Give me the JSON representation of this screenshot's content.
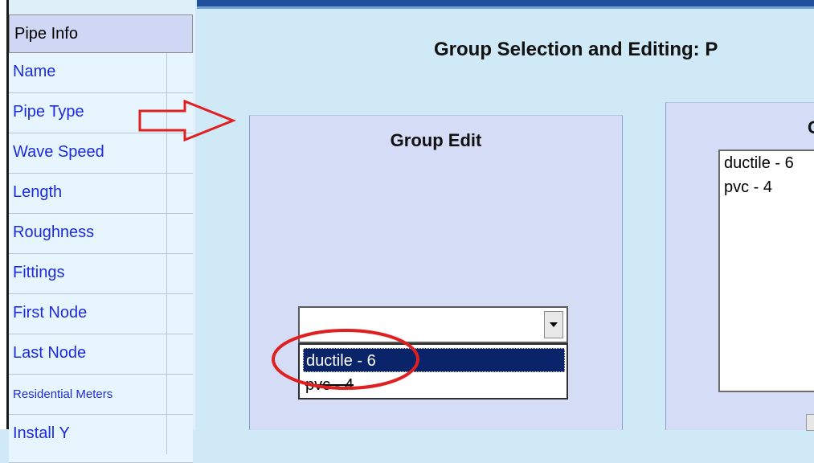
{
  "sidebar": {
    "header": "Pipe Info",
    "items": [
      {
        "label": "Name"
      },
      {
        "label": "Pipe Type"
      },
      {
        "label": "Wave Speed"
      },
      {
        "label": "Length"
      },
      {
        "label": "Roughness"
      },
      {
        "label": "Fittings"
      },
      {
        "label": "First Node"
      },
      {
        "label": "Last Node"
      },
      {
        "label": "Residential Meters"
      },
      {
        "label": "Install Y"
      }
    ]
  },
  "main": {
    "title": "Group Selection and Editing: P",
    "group_edit": {
      "title": "Group Edit",
      "select_value": "",
      "options": [
        "ductile - 6",
        "pvc - 4"
      ]
    },
    "right_panel": {
      "title": "G",
      "list_items": [
        "ductile - 6",
        "pvc - 4"
      ]
    }
  },
  "colors": {
    "sidebar_link": "#1d2be0",
    "panel_bg": "#d4dcf6",
    "page_bg": "#cfe9f7",
    "selected_option": "#0a246a",
    "annotation": "#e02020"
  },
  "icons": {
    "dropdown": "chevron-down-icon",
    "annotation_arrow": "arrow-right-icon",
    "annotation_circle": "circle-highlight-icon"
  }
}
